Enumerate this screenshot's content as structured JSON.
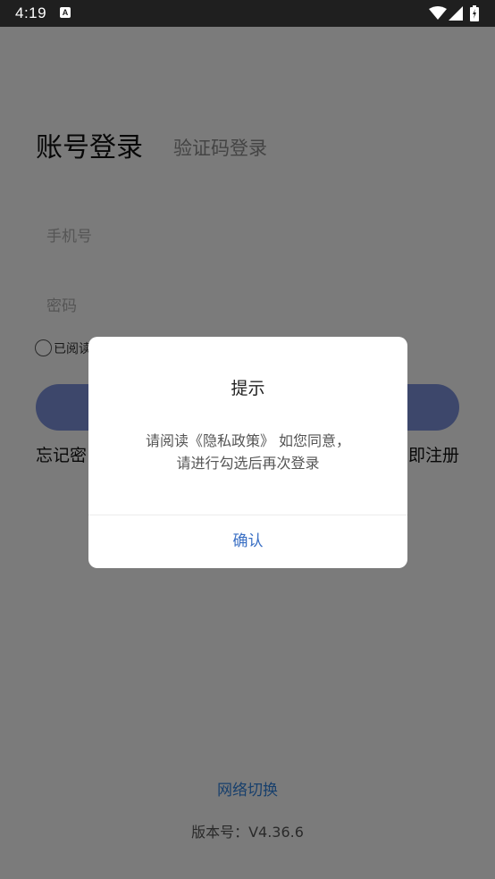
{
  "status_bar": {
    "time": "4:19",
    "notification_icon": "A"
  },
  "login": {
    "tab_account": "账号登录",
    "tab_code": "验证码登录",
    "phone_placeholder": "手机号",
    "password_placeholder": "密码",
    "agree_text": "已阅读",
    "forgot_text": "忘记密",
    "register_text": "即注册",
    "network_switch": "网络切换",
    "version": "版本号：V4.36.6",
    "button_color": "#7b8fd6"
  },
  "dialog": {
    "title": "提示",
    "message_line1": "请阅读《隐私政策》 如您同意，",
    "message_line2": "请进行勾选后再次登录",
    "confirm": "确认"
  },
  "colors": {
    "link": "#2f7fd8",
    "confirm": "#3a6fc4"
  }
}
